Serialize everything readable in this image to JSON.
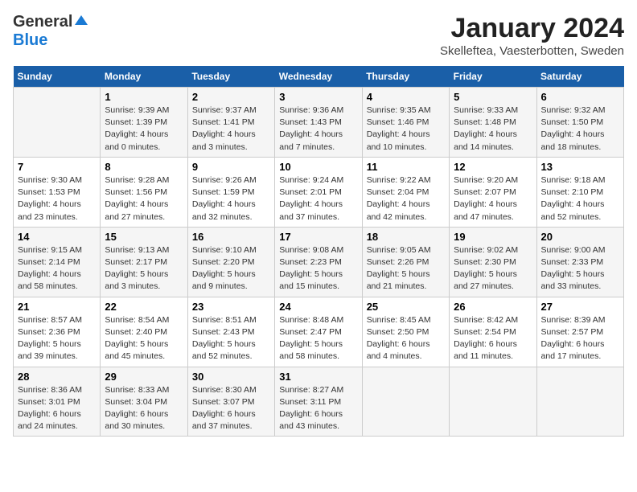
{
  "logo": {
    "line1": "General",
    "line2": "Blue"
  },
  "title": "January 2024",
  "subtitle": "Skelleftea, Vaesterbotten, Sweden",
  "days_header": [
    "Sunday",
    "Monday",
    "Tuesday",
    "Wednesday",
    "Thursday",
    "Friday",
    "Saturday"
  ],
  "weeks": [
    [
      {
        "num": "",
        "info": ""
      },
      {
        "num": "1",
        "info": "Sunrise: 9:39 AM\nSunset: 1:39 PM\nDaylight: 4 hours\nand 0 minutes."
      },
      {
        "num": "2",
        "info": "Sunrise: 9:37 AM\nSunset: 1:41 PM\nDaylight: 4 hours\nand 3 minutes."
      },
      {
        "num": "3",
        "info": "Sunrise: 9:36 AM\nSunset: 1:43 PM\nDaylight: 4 hours\nand 7 minutes."
      },
      {
        "num": "4",
        "info": "Sunrise: 9:35 AM\nSunset: 1:46 PM\nDaylight: 4 hours\nand 10 minutes."
      },
      {
        "num": "5",
        "info": "Sunrise: 9:33 AM\nSunset: 1:48 PM\nDaylight: 4 hours\nand 14 minutes."
      },
      {
        "num": "6",
        "info": "Sunrise: 9:32 AM\nSunset: 1:50 PM\nDaylight: 4 hours\nand 18 minutes."
      }
    ],
    [
      {
        "num": "7",
        "info": "Sunrise: 9:30 AM\nSunset: 1:53 PM\nDaylight: 4 hours\nand 23 minutes."
      },
      {
        "num": "8",
        "info": "Sunrise: 9:28 AM\nSunset: 1:56 PM\nDaylight: 4 hours\nand 27 minutes."
      },
      {
        "num": "9",
        "info": "Sunrise: 9:26 AM\nSunset: 1:59 PM\nDaylight: 4 hours\nand 32 minutes."
      },
      {
        "num": "10",
        "info": "Sunrise: 9:24 AM\nSunset: 2:01 PM\nDaylight: 4 hours\nand 37 minutes."
      },
      {
        "num": "11",
        "info": "Sunrise: 9:22 AM\nSunset: 2:04 PM\nDaylight: 4 hours\nand 42 minutes."
      },
      {
        "num": "12",
        "info": "Sunrise: 9:20 AM\nSunset: 2:07 PM\nDaylight: 4 hours\nand 47 minutes."
      },
      {
        "num": "13",
        "info": "Sunrise: 9:18 AM\nSunset: 2:10 PM\nDaylight: 4 hours\nand 52 minutes."
      }
    ],
    [
      {
        "num": "14",
        "info": "Sunrise: 9:15 AM\nSunset: 2:14 PM\nDaylight: 4 hours\nand 58 minutes."
      },
      {
        "num": "15",
        "info": "Sunrise: 9:13 AM\nSunset: 2:17 PM\nDaylight: 5 hours\nand 3 minutes."
      },
      {
        "num": "16",
        "info": "Sunrise: 9:10 AM\nSunset: 2:20 PM\nDaylight: 5 hours\nand 9 minutes."
      },
      {
        "num": "17",
        "info": "Sunrise: 9:08 AM\nSunset: 2:23 PM\nDaylight: 5 hours\nand 15 minutes."
      },
      {
        "num": "18",
        "info": "Sunrise: 9:05 AM\nSunset: 2:26 PM\nDaylight: 5 hours\nand 21 minutes."
      },
      {
        "num": "19",
        "info": "Sunrise: 9:02 AM\nSunset: 2:30 PM\nDaylight: 5 hours\nand 27 minutes."
      },
      {
        "num": "20",
        "info": "Sunrise: 9:00 AM\nSunset: 2:33 PM\nDaylight: 5 hours\nand 33 minutes."
      }
    ],
    [
      {
        "num": "21",
        "info": "Sunrise: 8:57 AM\nSunset: 2:36 PM\nDaylight: 5 hours\nand 39 minutes."
      },
      {
        "num": "22",
        "info": "Sunrise: 8:54 AM\nSunset: 2:40 PM\nDaylight: 5 hours\nand 45 minutes."
      },
      {
        "num": "23",
        "info": "Sunrise: 8:51 AM\nSunset: 2:43 PM\nDaylight: 5 hours\nand 52 minutes."
      },
      {
        "num": "24",
        "info": "Sunrise: 8:48 AM\nSunset: 2:47 PM\nDaylight: 5 hours\nand 58 minutes."
      },
      {
        "num": "25",
        "info": "Sunrise: 8:45 AM\nSunset: 2:50 PM\nDaylight: 6 hours\nand 4 minutes."
      },
      {
        "num": "26",
        "info": "Sunrise: 8:42 AM\nSunset: 2:54 PM\nDaylight: 6 hours\nand 11 minutes."
      },
      {
        "num": "27",
        "info": "Sunrise: 8:39 AM\nSunset: 2:57 PM\nDaylight: 6 hours\nand 17 minutes."
      }
    ],
    [
      {
        "num": "28",
        "info": "Sunrise: 8:36 AM\nSunset: 3:01 PM\nDaylight: 6 hours\nand 24 minutes."
      },
      {
        "num": "29",
        "info": "Sunrise: 8:33 AM\nSunset: 3:04 PM\nDaylight: 6 hours\nand 30 minutes."
      },
      {
        "num": "30",
        "info": "Sunrise: 8:30 AM\nSunset: 3:07 PM\nDaylight: 6 hours\nand 37 minutes."
      },
      {
        "num": "31",
        "info": "Sunrise: 8:27 AM\nSunset: 3:11 PM\nDaylight: 6 hours\nand 43 minutes."
      },
      {
        "num": "",
        "info": ""
      },
      {
        "num": "",
        "info": ""
      },
      {
        "num": "",
        "info": ""
      }
    ]
  ]
}
